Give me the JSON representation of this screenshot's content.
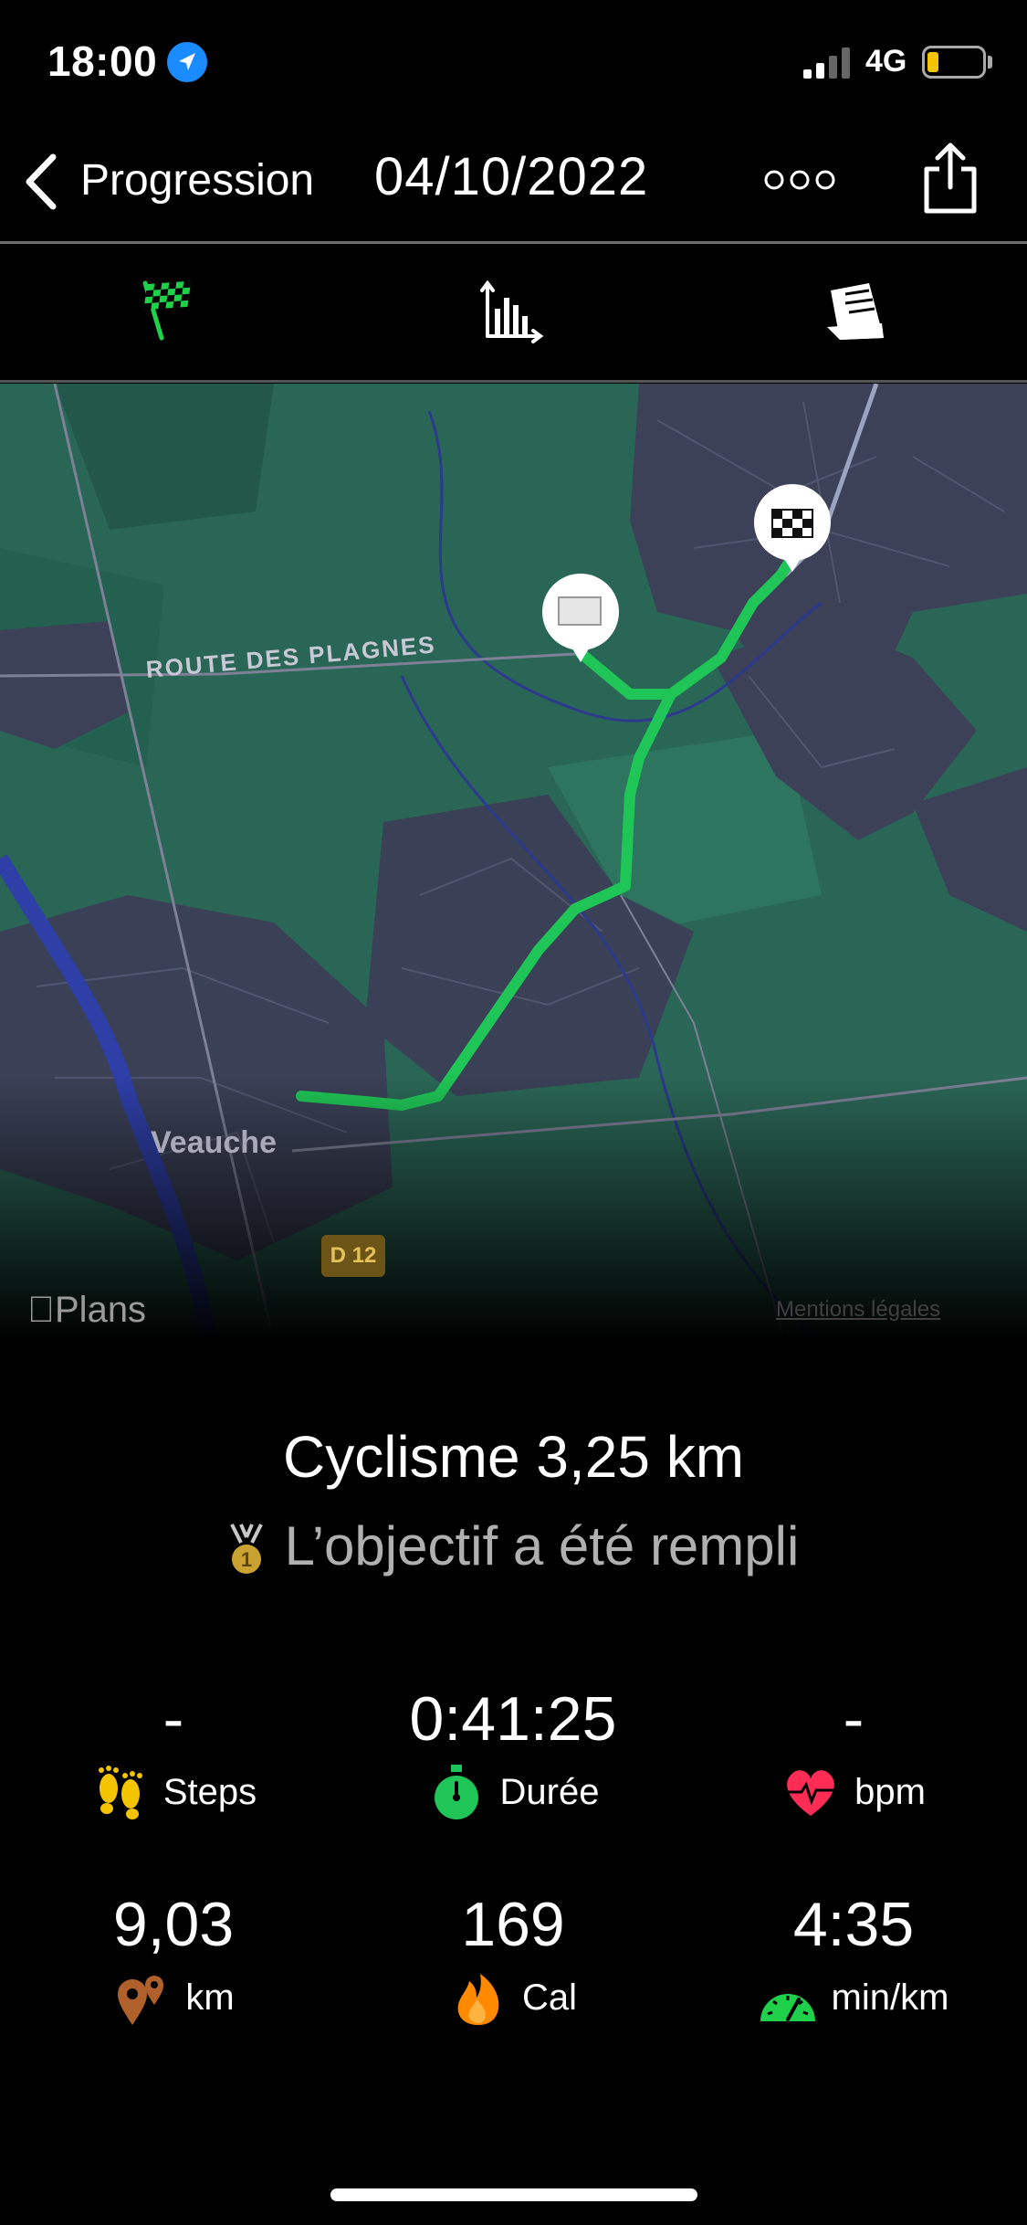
{
  "status_bar": {
    "time": "18:00",
    "network": "4G"
  },
  "nav": {
    "back_label": "Progression",
    "title": "04/10/2022"
  },
  "tabs": [
    {
      "icon": "checkered-flag-icon",
      "active": true
    },
    {
      "icon": "bar-chart-icon",
      "active": false
    },
    {
      "icon": "notes-icon",
      "active": false
    }
  ],
  "map": {
    "road_label": "ROUTE DES PLAGNES",
    "town_label": "Veauche",
    "road_badge": "D 12",
    "provider": "Plans",
    "legal": "Mentions légales"
  },
  "summary": {
    "activity": "Cyclisme 3,25 km",
    "goal": "L’objectif a été rempli"
  },
  "stats": [
    {
      "value": "-",
      "label": "Steps",
      "icon": "footprints-icon"
    },
    {
      "value": "0:41:25",
      "label": "Durée",
      "icon": "stopwatch-icon"
    },
    {
      "value": "-",
      "label": "bpm",
      "icon": "heart-rate-icon"
    },
    {
      "value": "9,03",
      "label": "km",
      "icon": "map-pins-icon"
    },
    {
      "value": "169",
      "label": "Cal",
      "icon": "flame-icon"
    },
    {
      "value": "4:35",
      "label": "min/km",
      "icon": "speedometer-icon"
    }
  ],
  "colors": {
    "accent_green": "#1fd14a",
    "route_green": "#1fc556",
    "map_land": "#2b6b58",
    "map_urban": "#3c4158",
    "heart_red": "#ff2d55",
    "flame_orange": "#ff8a00",
    "pin_brown": "#b0602a"
  }
}
